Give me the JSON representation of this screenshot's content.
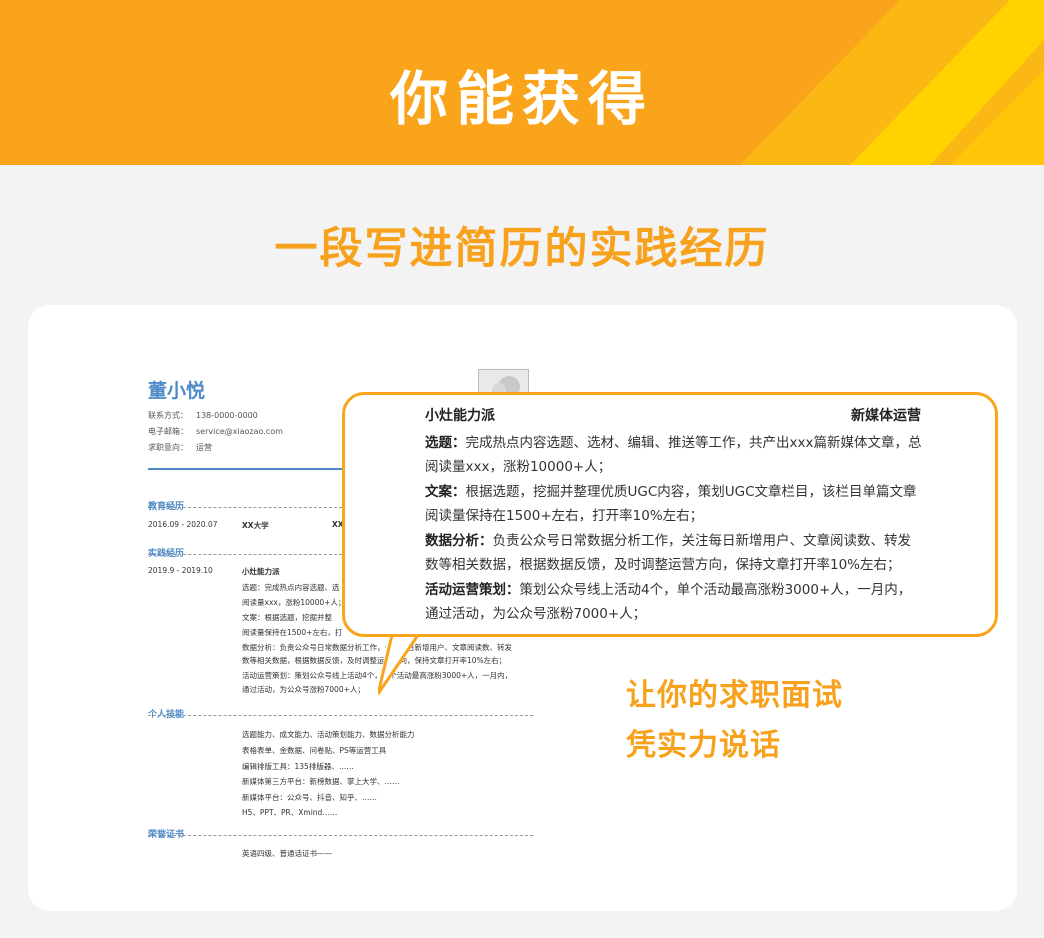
{
  "banner": {
    "title": "你能获得"
  },
  "subtitle": "一段写进简历的实践经历",
  "resume": {
    "name": "董小悦",
    "contact": [
      {
        "label": "联系方式：",
        "value": "138-0000-0000"
      },
      {
        "label": "电子邮箱：",
        "value": "service@xiaozao.com"
      },
      {
        "label": "求职意向：",
        "value": "运营"
      }
    ],
    "education": {
      "title": "教育经历",
      "period": "2016.09 - 2020.07",
      "school": "XX大学",
      "extra": "XX"
    },
    "practice": {
      "title": "实践经历",
      "period": "2019.9 - 2019.10",
      "org": "小灶能力派",
      "lines": [
        "选题：完成热点内容选题、选",
        "阅读量xxx，涨粉10000+人；",
        "文案：根据选题，挖掘并整",
        "阅读量保持在1500+左右，打",
        "数据分析：负责公众号日常数据分析工作，关注每日新增用户、文章阅读数、转发",
        "数等相关数据，根据数据反馈，及时调整运营方向，保持文章打开率10%左右；",
        "活动运营策划：策划公众号线上活动4个，单个活动最高涨粉3000+人，一月内，",
        "通过活动，为公众号涨粉7000+人；"
      ]
    },
    "skills": {
      "title": "个人技能",
      "lines": [
        "选题能力、成文能力、活动策划能力、数据分析能力",
        "表格表单、金数据、问卷贴、PS等运营工具",
        "编辑排版工具：135排版器、……",
        "新媒体第三方平台：新榜数据、掌上大学、……",
        "新媒体平台：公众号、抖音、知乎、……",
        "H5、PPT、PR、Xmind……"
      ]
    },
    "honors": {
      "title": "荣誉证书",
      "lines": [
        "英语四级、普通话证书——"
      ]
    }
  },
  "bubble": {
    "org": "小灶能力派",
    "role": "新媒体运营",
    "items": [
      {
        "label": "选题：",
        "lines": [
          "完成热点内容选题、选材、编辑、推送等工作，共产出xxx篇新媒体文章，总",
          "阅读量xxx，涨粉10000+人；"
        ]
      },
      {
        "label": "文案：",
        "lines": [
          "根据选题，挖掘并整理优质UGC内容，策划UGC文章栏目，该栏目单篇文章",
          "阅读量保持在1500+左右，打开率10%左右；"
        ]
      },
      {
        "label": "数据分析：",
        "lines": [
          "负责公众号日常数据分析工作，关注每日新增用户、文章阅读数、转发",
          "数等相关数据，根据数据反馈，及时调整运营方向，保持文章打开率10%左右；"
        ]
      },
      {
        "label": "活动运营策划：",
        "lines": [
          "策划公众号线上活动4个，单个活动最高涨粉3000+人，一月内，",
          "通过活动，为公众号涨粉7000+人；"
        ]
      }
    ]
  },
  "slogan": [
    "让你的求职面试",
    "凭实力说话"
  ],
  "colors": {
    "brand_orange": "#f9a41a",
    "accent_yellow": "#ffcc00",
    "resume_blue": "#4d8ac6"
  }
}
